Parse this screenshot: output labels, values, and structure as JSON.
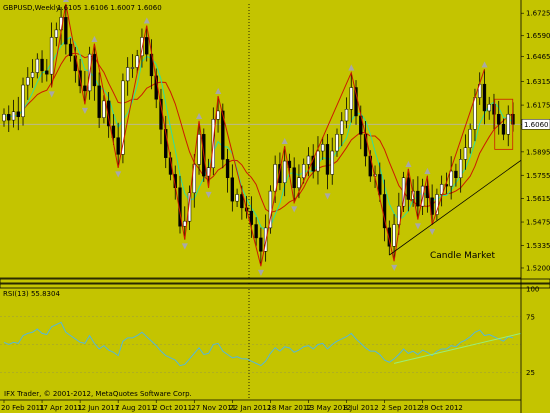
{
  "window": {
    "symbol": "GBPUSD,Weekly",
    "ohlc": "1.6105 1.6106 1.6007 1.6060"
  },
  "colors": {
    "background": "#c4c400",
    "up_candle": "#ffffff",
    "down_candle": "#000000",
    "zigzag": "#cc1a00",
    "ma_slow": "#cc1a00",
    "ma_fast": "#33dd99",
    "rsi_line": "#55b7d8",
    "rsi_trend": "#99ee77",
    "trendline": "#000000",
    "fractal": "#a8a8a8"
  },
  "chart_data": [
    {
      "type": "candlestick",
      "title": "GBPUSD,Weekly",
      "ylim": [
        1.514,
        1.678
      ],
      "y_ticks": [
        "1.6725",
        "1.6590",
        "1.6465",
        "1.6315",
        "1.6175",
        "1.6060",
        "1.5895",
        "1.5755",
        "1.5615",
        "1.5475",
        "1.5335",
        "1.5200"
      ],
      "last_price": "1.6060",
      "x_ticks": [
        "20 Feb 2011",
        "17 Apr 2011",
        "12 Jun 2011",
        "7 Aug 2011",
        "2 Oct 2011",
        "27 Nov 2011",
        "22 Jan 2012",
        "18 Mar 2012",
        "13 May 2012",
        "8 Jul 2012",
        "2 Sep 2012",
        "28 Oct 2012"
      ],
      "weeks_per_tick": 8,
      "close": [
        1.612,
        1.6085,
        1.6135,
        1.6105,
        1.6295,
        1.634,
        1.637,
        1.645,
        1.638,
        1.636,
        1.658,
        1.6625,
        1.67,
        1.654,
        1.647,
        1.638,
        1.629,
        1.626,
        1.648,
        1.629,
        1.61,
        1.62,
        1.605,
        1.598,
        1.588,
        1.632,
        1.64,
        1.64,
        1.647,
        1.658,
        1.648,
        1.635,
        1.621,
        1.603,
        1.586,
        1.576,
        1.568,
        1.545,
        1.548,
        1.565,
        1.582,
        1.6,
        1.575,
        1.58,
        1.609,
        1.614,
        1.585,
        1.574,
        1.56,
        1.564,
        1.556,
        1.554,
        1.546,
        1.538,
        1.53,
        1.544,
        1.566,
        1.582,
        1.571,
        1.584,
        1.58,
        1.568,
        1.574,
        1.582,
        1.587,
        1.578,
        1.59,
        1.594,
        1.576,
        1.59,
        1.6,
        1.608,
        1.615,
        1.628,
        1.611,
        1.6,
        1.587,
        1.575,
        1.576,
        1.564,
        1.544,
        1.533,
        1.546,
        1.557,
        1.574,
        1.561,
        1.566,
        1.557,
        1.569,
        1.562,
        1.552,
        1.564,
        1.57,
        1.569,
        1.578,
        1.574,
        1.585,
        1.592,
        1.603,
        1.622,
        1.63,
        1.614,
        1.618,
        1.612,
        1.606,
        1.6,
        1.612,
        1.606
      ]
    },
    {
      "type": "line",
      "title": "RSI(13) 55.8304",
      "ylim": [
        0,
        100
      ],
      "levels": [
        25,
        50,
        75
      ],
      "y_ticks": [
        "100",
        "75",
        "25"
      ],
      "values": [
        52,
        50,
        52,
        51,
        58,
        60,
        61,
        64,
        60,
        59,
        66,
        68,
        70,
        61,
        58,
        55,
        52,
        51,
        58,
        51,
        46,
        49,
        45,
        43,
        40,
        53,
        56,
        56,
        58,
        61,
        57,
        53,
        49,
        44,
        40,
        38,
        36,
        31,
        32,
        37,
        42,
        47,
        41,
        42,
        50,
        51,
        44,
        41,
        38,
        39,
        37,
        37,
        35,
        33,
        31,
        35,
        42,
        47,
        44,
        48,
        47,
        43,
        45,
        48,
        49,
        46,
        50,
        51,
        46,
        50,
        53,
        55,
        57,
        60,
        55,
        51,
        47,
        44,
        44,
        41,
        36,
        34,
        37,
        41,
        46,
        42,
        44,
        41,
        45,
        43,
        40,
        44,
        46,
        46,
        49,
        48,
        52,
        54,
        57,
        61,
        63,
        58,
        59,
        57,
        55,
        53,
        57,
        56
      ]
    }
  ],
  "overlay": {
    "watermark": "Candle Market",
    "copyright": "IFX Trader, © 2001-2012, MetaQuotes Software Corp."
  }
}
